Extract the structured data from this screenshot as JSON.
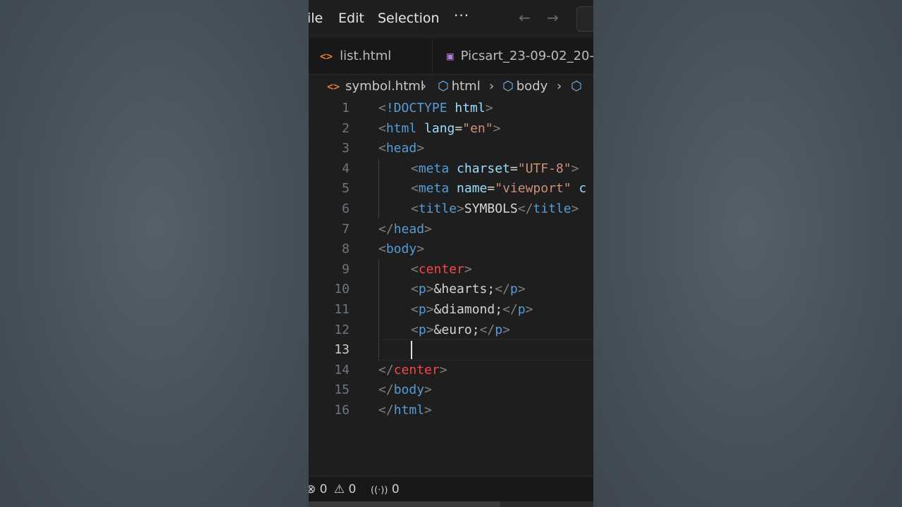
{
  "menubar": {
    "file": "ile",
    "edit": "Edit",
    "selection": "Selection",
    "more": "···",
    "back_icon": "←",
    "forward_icon": "→"
  },
  "tabs": [
    {
      "label": "list.html",
      "icon": "<>"
    },
    {
      "label": "Picsart_23-09-02_20-",
      "icon": "▣"
    }
  ],
  "breadcrumb": {
    "file": "symbol.html",
    "items": [
      "html",
      "body"
    ],
    "sep": "›",
    "cube": "⬡"
  },
  "editor": {
    "current_line": 13,
    "line_numbers": [
      "1",
      "2",
      "3",
      "4",
      "5",
      "6",
      "7",
      "8",
      "9",
      "10",
      "11",
      "12",
      "13",
      "14",
      "15",
      "16"
    ]
  },
  "code": {
    "l1": [
      "<",
      "!DOCTYPE",
      " html",
      ">"
    ],
    "l2": [
      "<",
      "html",
      " lang",
      "=",
      "\"en\"",
      ">"
    ],
    "l3": [
      "<",
      "head",
      ">"
    ],
    "l4": [
      "<",
      "meta",
      " charset",
      "=",
      "\"UTF-8\"",
      ">"
    ],
    "l5": [
      "<",
      "meta",
      " name",
      "=",
      "\"viewport\"",
      " c"
    ],
    "l6": [
      "<",
      "title",
      ">",
      "SYMBOLS",
      "</",
      "title",
      ">"
    ],
    "l7": [
      "</",
      "head",
      ">"
    ],
    "l8": [
      "<",
      "body",
      ">"
    ],
    "l9": [
      "<",
      "center",
      ">"
    ],
    "l10": [
      "<",
      "p",
      ">",
      "&hearts;",
      "</",
      "p",
      ">"
    ],
    "l11": [
      "<",
      "p",
      ">",
      "&diamond;",
      "</",
      "p",
      ">"
    ],
    "l12": [
      "<",
      "p",
      ">",
      "&euro;",
      "</",
      "p",
      ">"
    ],
    "l14": [
      "</",
      "center",
      ">"
    ],
    "l15": [
      "</",
      "body",
      ">"
    ],
    "l16": [
      "</",
      "html",
      ">"
    ]
  },
  "status": {
    "errors": "0",
    "warnings": "0",
    "ports": "0",
    "error_icon": "⊗",
    "warning_icon": "⚠",
    "broadcast_icon": "((·))"
  },
  "colors": {
    "editor_bg": "#1e1e1e",
    "tag": "#569cd6",
    "attribute": "#9cdcfe",
    "string": "#ce9178",
    "deprecated_tag": "#f44747",
    "punctuation": "#808080"
  }
}
